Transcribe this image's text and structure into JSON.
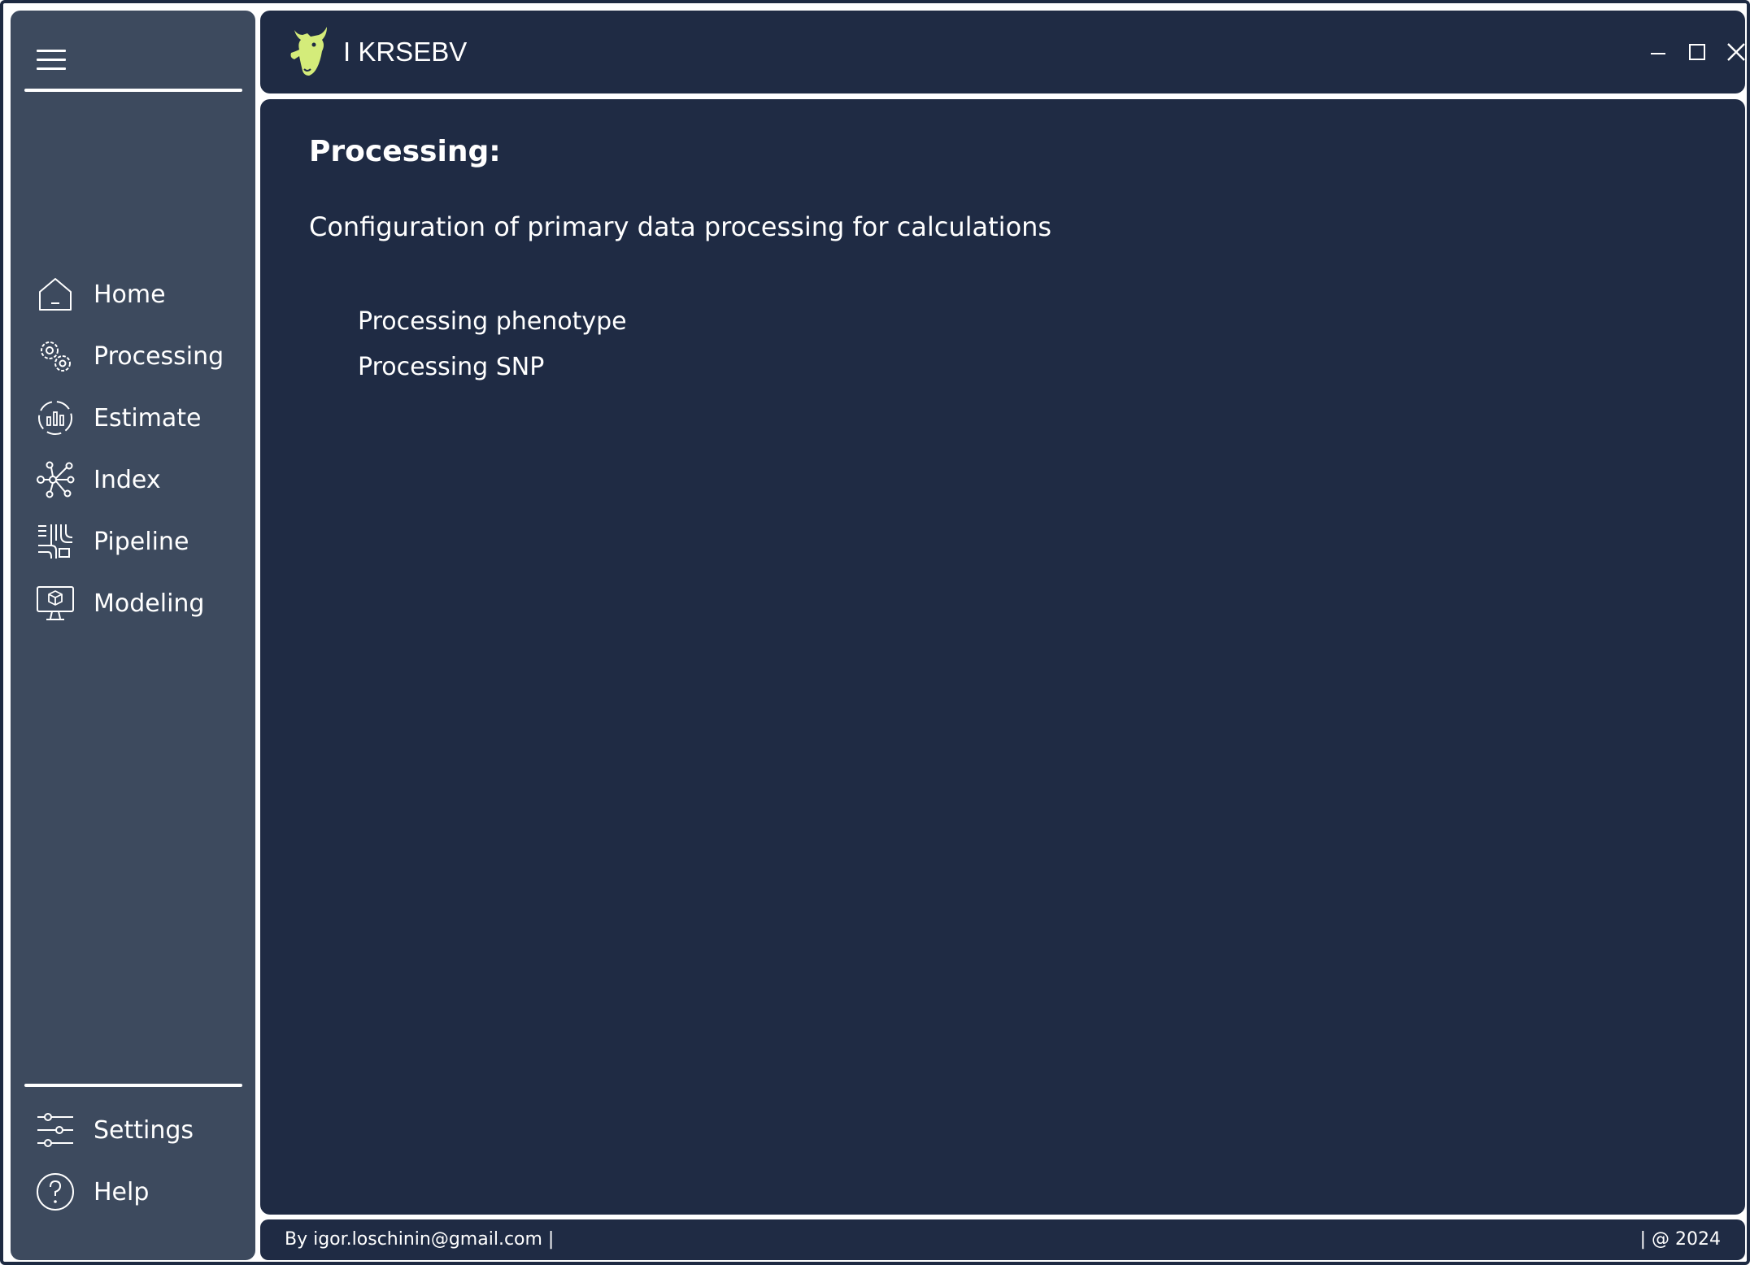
{
  "app": {
    "title": "I KRSEBV"
  },
  "sidebar": {
    "nav_items": [
      {
        "label": "Home",
        "icon": "home-icon"
      },
      {
        "label": "Processing",
        "icon": "gears-icon"
      },
      {
        "label": "Estimate",
        "icon": "estimate-chart-icon"
      },
      {
        "label": "Index",
        "icon": "network-icon"
      },
      {
        "label": "Pipeline",
        "icon": "pipeline-icon"
      },
      {
        "label": "Modeling",
        "icon": "monitor-cube-icon"
      }
    ],
    "bottom_items": [
      {
        "label": "Settings",
        "icon": "sliders-icon"
      },
      {
        "label": "Help",
        "icon": "question-icon"
      }
    ]
  },
  "main": {
    "title": "Processing:",
    "description": "Configuration of primary data processing for calculations",
    "links": [
      {
        "label": "Processing phenotype"
      },
      {
        "label": "Processing SNP"
      }
    ]
  },
  "footer": {
    "left": "By igor.loschinin@gmail.com |",
    "right": "| @ 2024"
  },
  "colors": {
    "sidebar_bg": "#3d4a5e",
    "panel_bg": "#1f2b44",
    "logo_accent": "#d4ec7a"
  }
}
